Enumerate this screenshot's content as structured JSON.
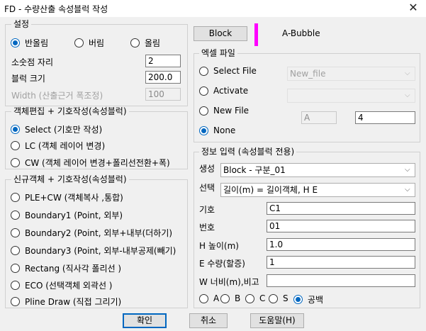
{
  "window": {
    "title": "FD - 수량산출 속성블럭 작성",
    "close_glyph": "✕"
  },
  "settings": {
    "group_label": "설정",
    "rounding": [
      {
        "label": "반올림",
        "checked": true
      },
      {
        "label": "버림",
        "checked": false
      },
      {
        "label": "올림",
        "checked": false
      }
    ],
    "decimal_label": "소숫점 자리",
    "decimal_value": "2",
    "block_size_label": "블럭 크기",
    "block_size_value": "200.0",
    "width_label": "Width (산출근거 폭조정)",
    "width_value": "100"
  },
  "object_edit": {
    "group_label": "객체편집 + 기호작성(속성블럭)",
    "options": [
      {
        "label": "Select (기호만 작성)",
        "checked": true
      },
      {
        "label": "LC (객체 레이어 변경)",
        "checked": false
      },
      {
        "label": "CW (객체 레이어 변경+폴리선전환+폭)",
        "checked": false
      }
    ]
  },
  "new_object": {
    "group_label": "신규객체  + 기호작성(속성블럭)",
    "options": [
      {
        "label": "PLE+CW (객체복사  ,통합)",
        "checked": false
      },
      {
        "label": "Boundary1 (Point, 외부)",
        "checked": false
      },
      {
        "label": "Boundary2 (Point, 외부+내부(더하기)",
        "checked": false
      },
      {
        "label": "Boundary3 (Point, 외부-내부공제(빼기)",
        "checked": false
      },
      {
        "label": "Rectang (직사각 폴리선 )",
        "checked": false
      },
      {
        "label": "ECO  (선택객체 외곽선 )",
        "checked": false
      },
      {
        "label": "Pline Draw (직접 그리기)",
        "checked": false
      }
    ]
  },
  "block": {
    "button_label": "Block",
    "name": "A-Bubble",
    "swatch_color": "#ff00ff"
  },
  "excel": {
    "group_label": "엑셀 파일",
    "select_file_label": "Select File",
    "select_file_value": "New_file",
    "activate_label": "Activate",
    "activate_value": "",
    "new_file_label": "New File",
    "new_file_value1": "A",
    "new_file_value2": "4",
    "none_label": "None",
    "mode": "None"
  },
  "info": {
    "group_label": "정보 입력 (속성블럭 전용)",
    "create_label": "생성",
    "create_value": "Block - 구분_01",
    "select_label": "선택",
    "select_value": "길이(m) = 길이객체, H E",
    "symbol_label": "기호",
    "symbol_value": "C1",
    "number_label": "번호",
    "number_value": "01",
    "h_label": "H 높이(m)",
    "h_value": "1.0",
    "e_label": "E 수량(할증)",
    "e_value": "1",
    "w_label": "W 너비(m),비고",
    "w_value": "",
    "choices": [
      {
        "label": "A",
        "checked": false
      },
      {
        "label": "B",
        "checked": false
      },
      {
        "label": "C",
        "checked": false
      },
      {
        "label": "S",
        "checked": false
      },
      {
        "label": "공백",
        "checked": true
      }
    ]
  },
  "buttons": {
    "ok": "확인",
    "cancel": "취소",
    "help": "도움말(H)"
  }
}
